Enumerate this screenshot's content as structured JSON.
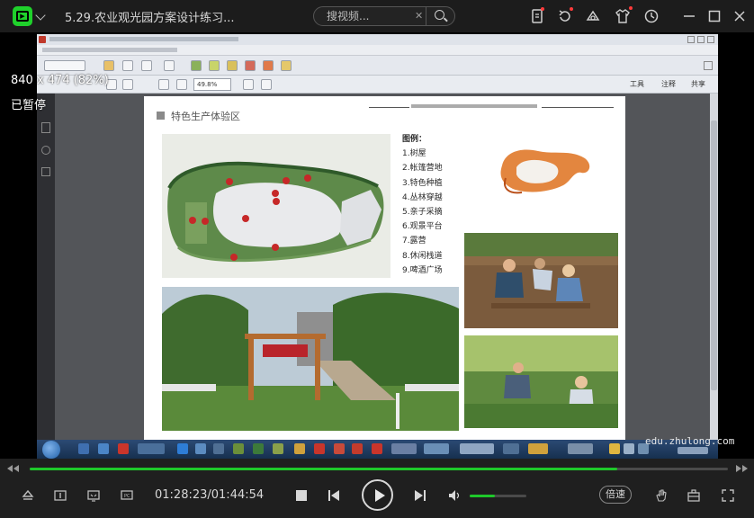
{
  "app": {
    "title": "5.29.农业观光园方案设计练习...",
    "logo_icon": "player-logo-icon",
    "accent": "#1ec82a"
  },
  "search": {
    "placeholder": "搜视频..."
  },
  "overlay": {
    "size_text": "840 x 474 (82%)",
    "status_text": "已暂停"
  },
  "document": {
    "section_title": "特色生产体验区",
    "legend_title": "图例：",
    "legend_items": [
      "1.树屋",
      "2.帐篷营地",
      "3.特色种植",
      "4.丛林穿越",
      "5.亲子采摘",
      "6.观景平台",
      "7.露营",
      "8.休闲栈道",
      "9.啤酒广场"
    ],
    "zoom": "49.8%",
    "toolbar_right": [
      "工具",
      "注释",
      "共享"
    ]
  },
  "watermark": "edu.zhulong.com",
  "player": {
    "time": "01:28:23/01:44:54",
    "progress": 0.842,
    "volume": 0.45,
    "speed_label": "倍速"
  }
}
